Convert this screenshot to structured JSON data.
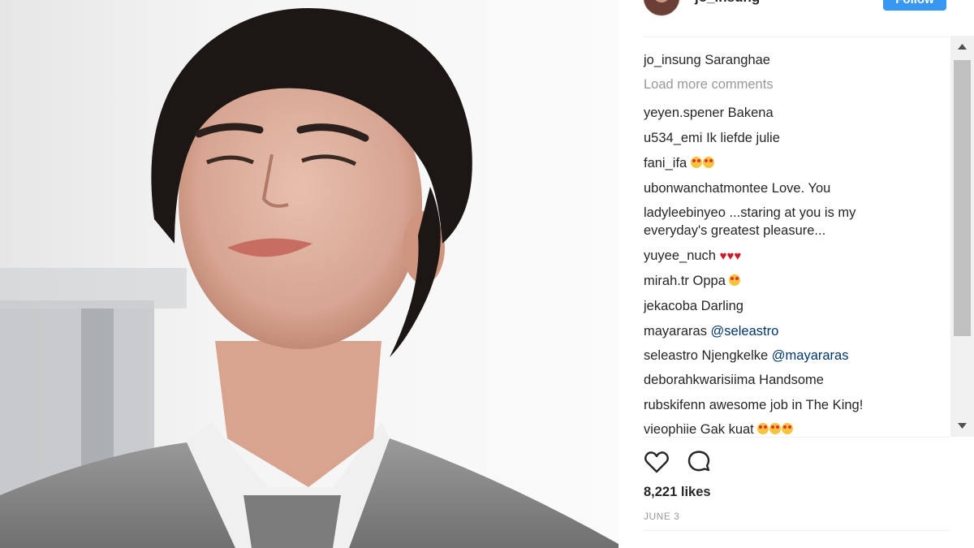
{
  "post": {
    "photo_alt": "photo",
    "author": "jo_insung",
    "follow_label": "Follow"
  },
  "caption": {
    "user": "jo_insung",
    "text": "Saranghae"
  },
  "load_more_label": "Load more comments",
  "comments": [
    {
      "user": "yeyen.spener",
      "text": "Bakena"
    },
    {
      "user": "u534_emi",
      "text": "Ik liefde julie"
    },
    {
      "user": "fani_ifa",
      "emoji": "smiling-face-with-heart-eyes x2"
    },
    {
      "user": "ubonwanchatmontee",
      "text": "Love. You"
    },
    {
      "user": "ladyleebinyeo",
      "text": "...staring at you is my",
      "text2": "everyday's greatest pleasure..."
    },
    {
      "user": "yuyee_nuch",
      "emoji": "red-heart x3"
    },
    {
      "user": "mirah.tr",
      "text": "Oppa",
      "emoji": "smiling-face-with-heart-eyes"
    },
    {
      "user": "jekacoba",
      "text": "Darling"
    },
    {
      "user": "mayararas",
      "mention": "@seleastro"
    },
    {
      "user": "seleastro",
      "text": "Njengkelke",
      "mention": "@mayararas"
    },
    {
      "user": "deborahkwarisiima",
      "text": "Handsome"
    },
    {
      "user": "rubskifenn",
      "text": "awesome job in The King!"
    },
    {
      "user": "vieophiie",
      "text": "Gak kuat",
      "emoji": "smiling-face-with-heart-eyes x3"
    }
  ],
  "likes_label": "8,221 likes",
  "date_label": "JUNE 3",
  "icons": {
    "like": "heart-outline-icon",
    "comment": "speech-bubble-icon",
    "scroll_up": "triangle-up-icon",
    "scroll_down": "triangle-down-icon"
  },
  "colors": {
    "follow": "#3897f0",
    "text": "#262626",
    "muted": "#999999",
    "mention": "#003569"
  }
}
